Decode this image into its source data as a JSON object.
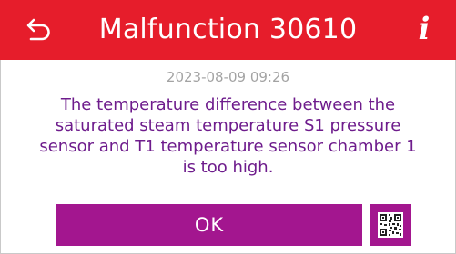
{
  "header": {
    "title": "Malfunction 30610",
    "back_icon": "back-arrow-icon",
    "info_icon": "info-icon",
    "info_glyph": "i",
    "color": "#e61d2b"
  },
  "dialog": {
    "timestamp": "2023-08-09 09:26",
    "message": "The temperature difference between the saturated steam temperature S1 pressure sensor and T1 temperature sensor chamber 1 is too high."
  },
  "actions": {
    "ok_label": "OK",
    "qr_icon": "qr-code-icon",
    "button_color": "#a3168f",
    "text_color": "#6e1c8c"
  }
}
